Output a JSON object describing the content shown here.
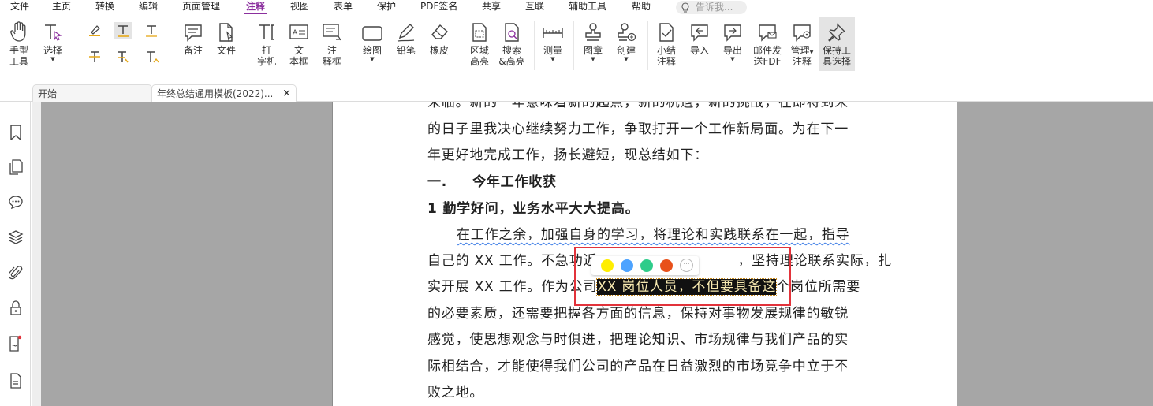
{
  "menubar": {
    "items": [
      "文件",
      "主页",
      "转换",
      "编辑",
      "页面管理",
      "注释",
      "视图",
      "表单",
      "保护",
      "PDF签名",
      "共享",
      "互联",
      "辅助工具",
      "帮助"
    ],
    "active": "注释",
    "tell_me_placeholder": "告诉我..."
  },
  "ribbon": {
    "hand_tool": [
      "手型",
      "工具"
    ],
    "select": "选择",
    "note": "备注",
    "file": "文件",
    "typewriter": [
      "打",
      "字机"
    ],
    "textbox": [
      "文",
      "本框"
    ],
    "callout": [
      "注",
      "释框"
    ],
    "drawing": "绘图",
    "pencil": "铅笔",
    "eraser": "橡皮",
    "area_highlight": [
      "区域",
      "高亮"
    ],
    "search_highlight": [
      "搜索",
      "&高亮"
    ],
    "measure": "测量",
    "stamp": "图章",
    "create": "创建",
    "summarize": [
      "小结",
      "注释"
    ],
    "import": "导入",
    "export": "导出",
    "email": [
      "邮件发",
      "送FDF"
    ],
    "manage": [
      "管理",
      "注释"
    ],
    "keep_tool": [
      "保持工",
      "具选择"
    ]
  },
  "tabs": {
    "start": "开始",
    "document": "年终总结通用模板(2022)...",
    "close_glyph": "×"
  },
  "document": {
    "line1": "来临。新的一年意味着新的起点，新的机遇，新的挑战，在即将到来",
    "line2": "的日子里我决心继续努力工作，争取打开一个工作新局面。为在下一",
    "line3": "年更好地完成工作，扬长避短，现总结如下：",
    "heading1_num": "一.",
    "heading1": "今年工作收获",
    "heading2": "1   勤学好问，业务水平大大提高。",
    "line6": "在工作之余，加强自身的学习，将理论和实践联系在一起，指导",
    "line7a": "自己的 XX 工作。不急功近",
    "line7b": "，坚持理论联系实际，扎",
    "line8a": "实开展 XX 工作。作为公司",
    "line8_highlight": "XX 岗位人员，不但要具备这",
    "line8b": "个岗位所需要",
    "line9": "的必要素质，还需要把握各方面的信息，保持对事物发展规律的敏锐",
    "line10": "感觉，使思想观念与时俱进，把理论知识、市场规律与我们产品的实",
    "line11": "际相结合，才能使得我们公司的产品在日益激烈的市场竞争中立于不",
    "line12": "败之地。"
  },
  "color_popup": {
    "colors": [
      "#ffee00",
      "#4da3ff",
      "#2ecc8a",
      "#e8501a"
    ],
    "more_glyph": "···"
  }
}
